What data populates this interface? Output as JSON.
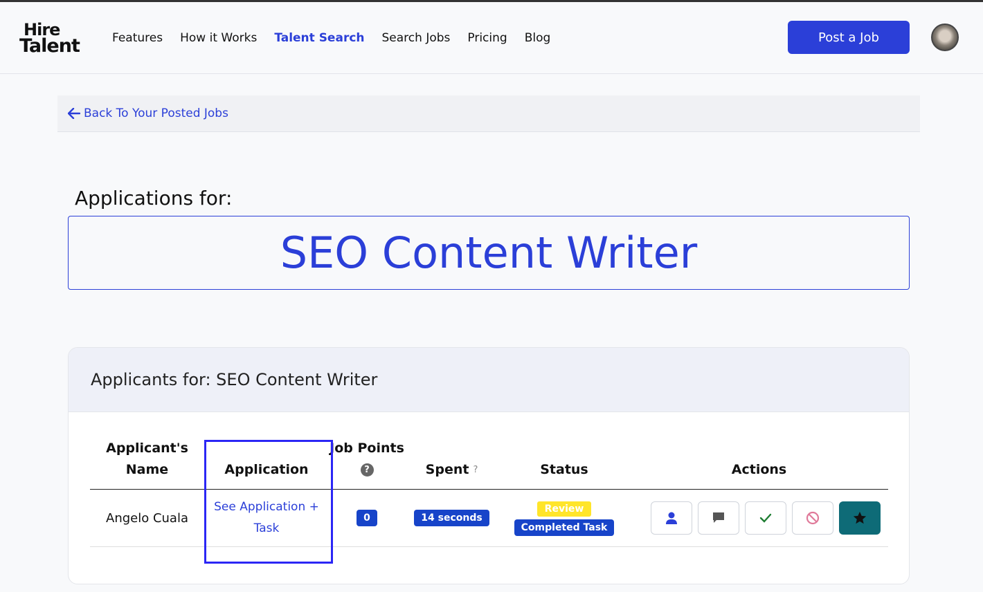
{
  "brand": {
    "line1": "Hire",
    "line2": "Talent",
    "accent_color": "#2b3fd8"
  },
  "nav": {
    "items": [
      {
        "label": "Features",
        "active": false
      },
      {
        "label": "How it Works",
        "active": false
      },
      {
        "label": "Talent Search",
        "active": true
      },
      {
        "label": "Search Jobs",
        "active": false
      },
      {
        "label": "Pricing",
        "active": false
      },
      {
        "label": "Blog",
        "active": false
      }
    ],
    "post_job_label": "Post a Job"
  },
  "back_link": {
    "label": "Back To Your Posted Jobs",
    "icon": "arrow-left-icon"
  },
  "page": {
    "applications_for_label": "Applications for:",
    "job_title": "SEO Content Writer"
  },
  "applicants_card": {
    "title": "Applicants for: SEO Content Writer",
    "columns": {
      "name": "Applicant's Name",
      "application": "Application",
      "job_points": "Job Points",
      "job_points_help": "?",
      "spent": "Spent",
      "spent_help": "?",
      "status": "Status",
      "actions": "Actions"
    },
    "rows": [
      {
        "name": "Angelo Cuala",
        "application_link": "See Application + Task",
        "job_points": "0",
        "spent": "14 seconds",
        "status_primary": "Review",
        "status_secondary": "Completed Task",
        "actions": [
          "user-icon",
          "comment-icon",
          "check-icon",
          "ban-icon",
          "star-icon"
        ]
      }
    ]
  },
  "colors": {
    "primary": "#2b3fd8",
    "badge_blue": "#1744c9",
    "badge_yellow": "#ffe52a",
    "favorite_teal": "#0e6b77",
    "highlight_box": "#2b26f5"
  }
}
